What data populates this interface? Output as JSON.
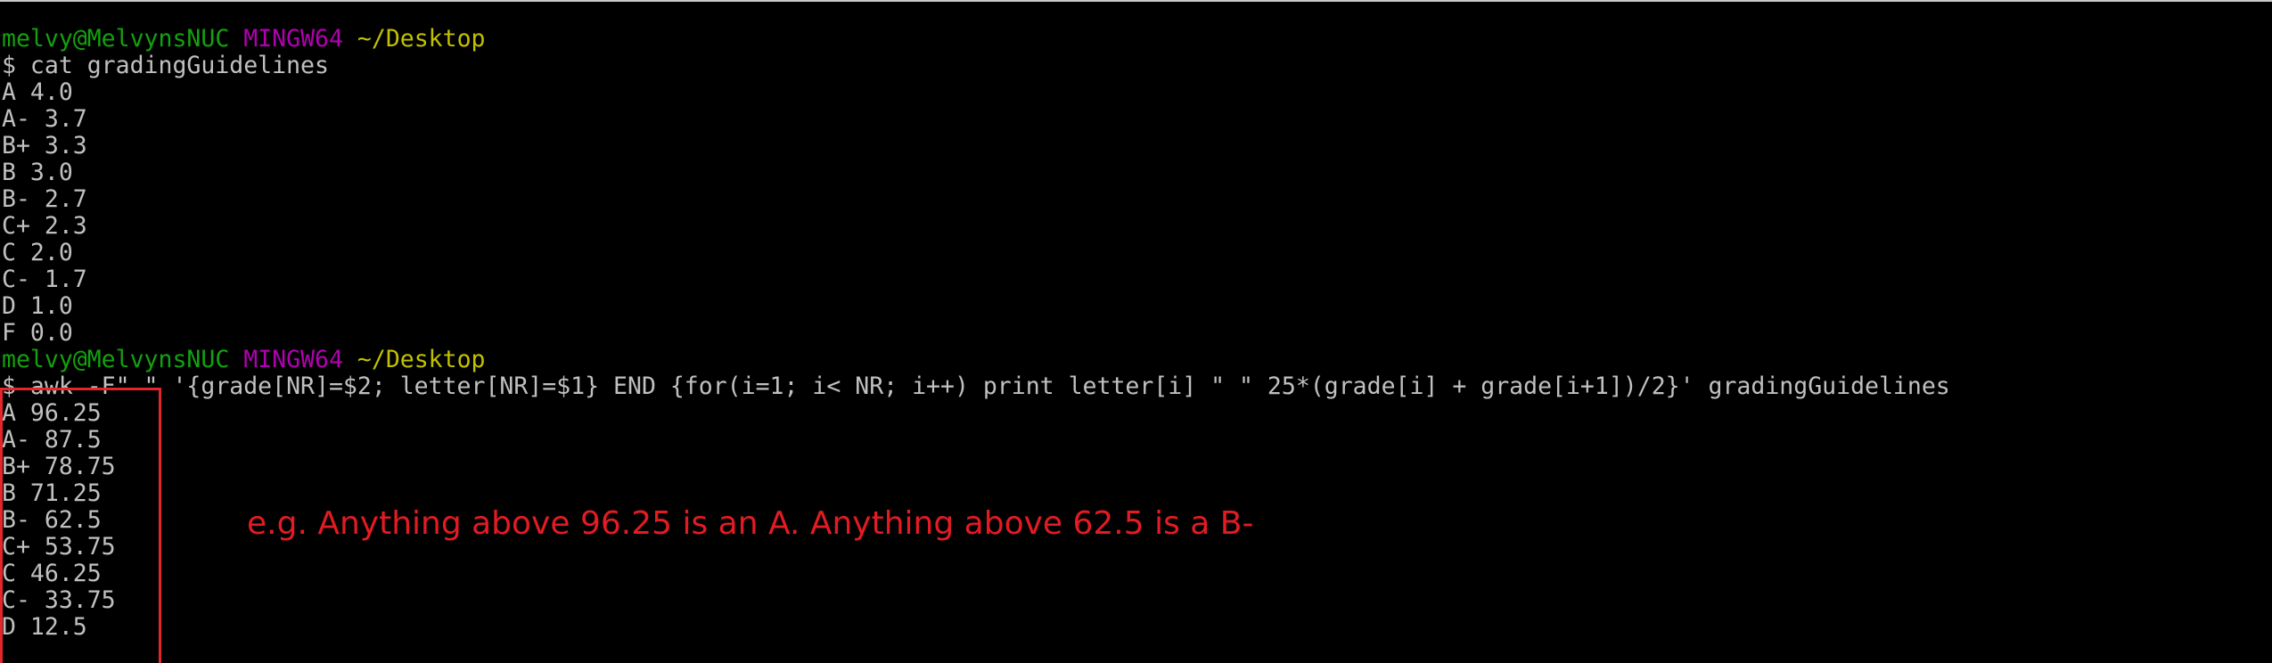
{
  "prompt1": {
    "user": "melvy@MelvynsNUC",
    "shell": "MINGW64",
    "path": "~/Desktop"
  },
  "command1": "$ cat gradingGuidelines",
  "grading_output": [
    "A 4.0",
    "A- 3.7",
    "B+ 3.3",
    "B 3.0",
    "B- 2.7",
    "C+ 2.3",
    "C 2.0",
    "C- 1.7",
    "D 1.0",
    "F 0.0"
  ],
  "prompt2": {
    "user": "melvy@MelvynsNUC",
    "shell": "MINGW64",
    "path": "~/Desktop"
  },
  "command2": "$ awk -F\" \" '{grade[NR]=$2; letter[NR]=$1} END {for(i=1; i< NR; i++) print letter[i] \" \" 25*(grade[i] + grade[i+1])/2}' gradingGuidelines",
  "awk_output": [
    "A 96.25",
    "A- 87.5",
    "B+ 78.75",
    "B 71.25",
    "B- 62.5",
    "C+ 53.75",
    "C 46.25",
    "C- 33.75",
    "D 12.5"
  ],
  "annotation": "e.g. Anything above 96.25 is an A. Anything above 62.5 is a B-",
  "colors": {
    "background": "#000000",
    "text": "#c0c0c0",
    "prompt_user": "#13a10e",
    "prompt_shell": "#b100b1",
    "prompt_path": "#c1c100",
    "annotation": "#e31b23"
  }
}
